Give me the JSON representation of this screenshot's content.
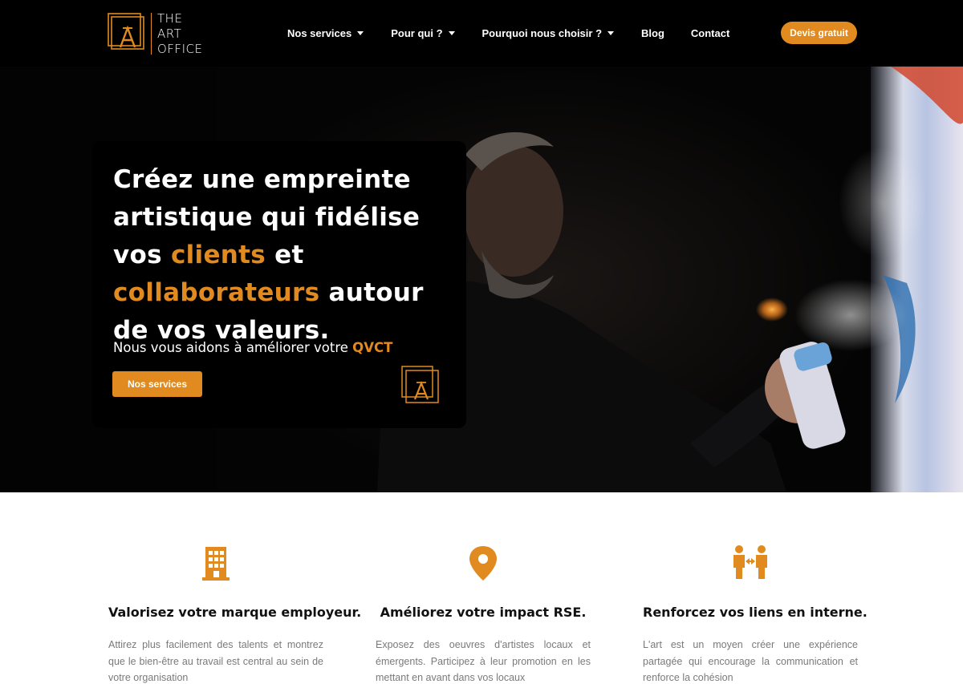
{
  "brand": {
    "name_lines": [
      "THE",
      "ART",
      "OFFICE"
    ],
    "accent_color": "#e08a1f",
    "logo_icon": "art-office-monogram-icon"
  },
  "nav": {
    "items": [
      {
        "label": "Nos services",
        "has_dropdown": true
      },
      {
        "label": "Pour qui ?",
        "has_dropdown": true
      },
      {
        "label": "Pourquoi nous choisir ?",
        "has_dropdown": true
      },
      {
        "label": "Blog",
        "has_dropdown": false
      },
      {
        "label": "Contact",
        "has_dropdown": false
      }
    ],
    "cta_label": "Devis gratuit"
  },
  "hero": {
    "title_part1": "Créez une empreinte artistique qui fidélise vos",
    "title_accent1": "clients",
    "title_and": "et",
    "title_accent2": "collaborateurs",
    "title_part2": "autour de vos valeurs.",
    "subtitle_prefix": "Nous vous aidons à améliorer votre",
    "subtitle_accent": "QVCT",
    "button_label": "Nos services"
  },
  "features": [
    {
      "icon": "building-icon",
      "title": "Valorisez votre marque employeur.",
      "text": "Attirez plus facilement des talents et montrez que le bien-être au travail est central au sein de votre organisation"
    },
    {
      "icon": "map-pin-icon",
      "title": "Améliorez votre impact RSE.",
      "text": "Exposez des oeuvres d'artistes locaux et émergents. Participez à leur promotion en les mettant en avant dans vos locaux"
    },
    {
      "icon": "people-exchange-icon",
      "title": "Renforcez vos liens en interne.",
      "text": "L'art est un moyen créer une expérience partagée qui encourage la communication et renforce la cohésion"
    }
  ]
}
